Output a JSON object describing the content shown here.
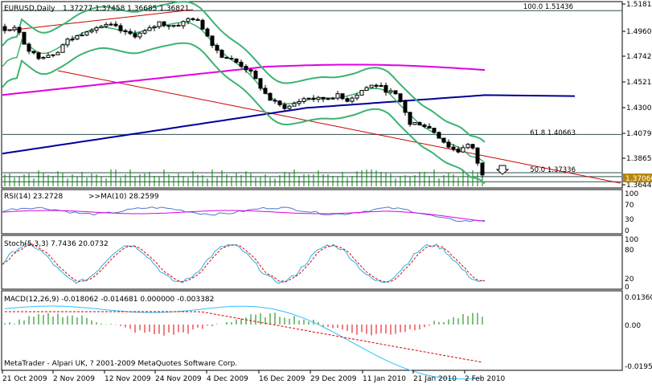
{
  "main_header": {
    "symbol": "EURUSD,Daily",
    "ohlc": "1.37277 1.37458 1.36685 1.36821"
  },
  "fib_levels": [
    {
      "label": "100.0 1.51436",
      "price": 1.51436
    },
    {
      "label": "61.8 1.40663",
      "price": 1.40663
    },
    {
      "label": "50.0 1.37336",
      "price": 1.37336
    }
  ],
  "price_axis": {
    "ticks": [
      "1.51810",
      "1.49605",
      "1.47425",
      "1.45215",
      "1.43005",
      "1.40795",
      "1.38650",
      "1.36440"
    ],
    "ymin": 1.3608,
    "ymax": 1.5215,
    "current_price": "1.37066"
  },
  "rsi": {
    "header": "RSI(14) 23.2728",
    "ma_header": ">>MA(10) 28.2599",
    "ticks": [
      "100",
      "70",
      "30",
      "0"
    ]
  },
  "stoch": {
    "header": "Stoch(5,3,3) 7.7436 20.0732",
    "ticks": [
      "100",
      "80",
      "20",
      "0"
    ]
  },
  "macd": {
    "header": "MACD(12,26,9) -0.018062 -0.014681 0.000000 -0.003382",
    "ticks": [
      "0.013608",
      "0.00",
      "-0.019557"
    ]
  },
  "copyright": "MetaTrader - Alpari UK, ? 2001-2009 MetaQuotes Software Corp.",
  "date_axis": [
    "21 Oct 2009",
    "2 Nov 2009",
    "12 Nov 2009",
    "24 Nov 2009",
    "4 Dec 2009",
    "16 Dec 2009",
    "29 Dec 2009",
    "11 Jan 2010",
    "21 Jan 2010",
    "2 Feb 2010"
  ],
  "colors": {
    "grid_border": "#000000",
    "fib_line": "#2f4f4f",
    "trend_line": "#cc0000",
    "bollinger": "#3cb371",
    "ma_fast": "#e000e0",
    "ma_slow": "#000099",
    "volume": "#008000",
    "rsi_main": "#4a7ad0",
    "rsi_ma": "#e000e0",
    "stoch_main": "#2ab0e0",
    "stoch_signal": "#e00000",
    "macd_hist_pos": "#008000",
    "macd_hist_neg": "#e00000",
    "macd_line": "#30c0ff",
    "macd_signal": "#e00000",
    "price_label_bg": "#b8860b"
  }
}
